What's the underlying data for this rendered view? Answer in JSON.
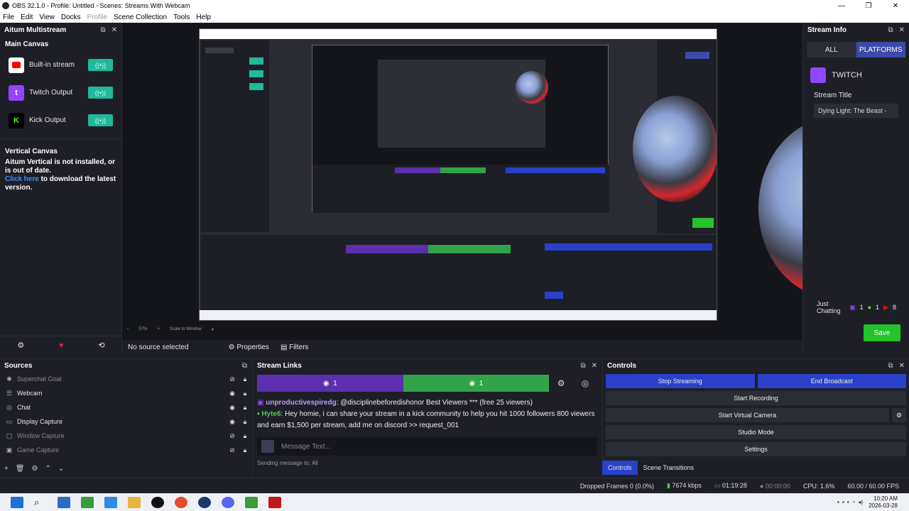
{
  "window": {
    "title": "OBS 32.1.0 - Profile: Untitled - Scenes: Streams With Webcam"
  },
  "menu": [
    "File",
    "Edit",
    "View",
    "Docks",
    "Profile",
    "Scene Collection",
    "Tools",
    "Help"
  ],
  "multistream": {
    "title": "Aitum Multistream",
    "main_canvas": "Main Canvas",
    "outputs": [
      {
        "label": "Built-in stream",
        "platform_icon": "youtube-icon",
        "color": "#ff0000"
      },
      {
        "label": "Twitch Output",
        "platform_icon": "twitch-icon",
        "color": "#9146ff"
      },
      {
        "label": "Kick Output",
        "platform_icon": "kick-icon",
        "color": "#53fc18"
      }
    ],
    "toggle_glyph": "((•))",
    "vertical_canvas": "Vertical Canvas",
    "warning": "Aitum Vertical is not installed, or is out of date.",
    "link_text": "Click here",
    "link_suffix": " to download the latest version."
  },
  "preview_toolbar": {
    "no_source": "No source selected",
    "properties": "Properties",
    "filters": "Filters",
    "zoom": "57%",
    "scale": "Scale to Window"
  },
  "stream_info": {
    "title": "Stream Info",
    "tab_all": "ALL",
    "tab_platforms": "PLATFORMS",
    "platform": "TWITCH",
    "stream_title_label": "Stream Title",
    "stream_title_value": "Dying Light: The Beast -",
    "category": "Just Chatting",
    "twitch_count": "1",
    "kick_count": "1",
    "yt_count": "8",
    "save": "Save"
  },
  "sources": {
    "title": "Sources",
    "items": [
      {
        "name": "Superchat Goal",
        "icon": "puzzle-icon",
        "visible": false
      },
      {
        "name": "Webcam",
        "icon": "list-icon",
        "visible": true
      },
      {
        "name": "Chat",
        "icon": "globe-icon",
        "visible": true
      },
      {
        "name": "Display Capture",
        "icon": "monitor-icon",
        "visible": true
      },
      {
        "name": "Window Capture",
        "icon": "window-icon",
        "visible": false
      },
      {
        "name": "Game Capture",
        "icon": "gamepad-icon",
        "visible": false
      }
    ]
  },
  "stream_links": {
    "title": "Stream Links",
    "twitch_viewers": "1",
    "kick_viewers": "1",
    "chat": [
      {
        "user": "unproductivespiredg",
        "text": ": @disciplinebeforedishonor Best Viewers *** (free 25 viewers)",
        "platform": "twitch"
      },
      {
        "user": "Hyte6",
        "text": ": Hey homie, i can share your stream in a kick community to help you hit 1000 followers 800 viewers and earn $1,500 per stream, add me on discord >> request_001",
        "platform": "kick"
      }
    ],
    "input_placeholder": "Message Text...",
    "sending_to": "Sending message to: All"
  },
  "controls": {
    "title": "Controls",
    "stop_streaming": "Stop Streaming",
    "end_broadcast": "End Broadcast",
    "start_recording": "Start Recording",
    "start_virtual_camera": "Start Virtual Camera",
    "studio_mode": "Studio Mode",
    "settings": "Settings",
    "tab_controls": "Controls",
    "tab_transitions": "Scene Transitions"
  },
  "status": {
    "dropped": "Dropped Frames 0 (0.0%)",
    "bitrate": "7674 kbps",
    "stream_time": "01:19:28",
    "rec_time": "00:00:00",
    "cpu": "CPU: 1.6%",
    "fps": "60.00 / 60.00 FPS"
  },
  "clock": {
    "time": "10:20 AM",
    "date": "2026-03-28"
  },
  "colors": {
    "accent": "#2841c8",
    "twitch": "#9146ff",
    "kick": "#31a34a",
    "toggle": "#20b99a"
  }
}
